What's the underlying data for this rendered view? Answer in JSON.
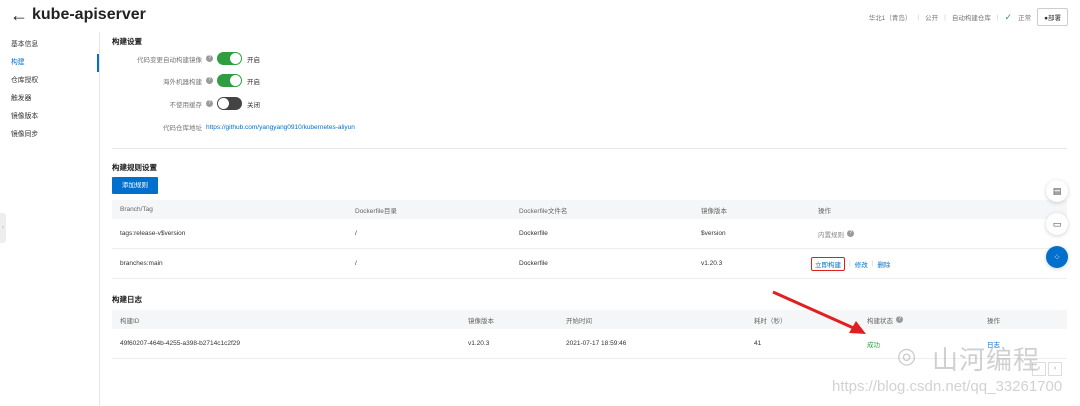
{
  "header": {
    "back_glyph": "←",
    "title": "kube-apiserver",
    "region": "华北1（青岛）",
    "visibility": "公开",
    "auto_build": "自动构建仓库",
    "status": "正常",
    "deploy_label": "●部署"
  },
  "sidebar": {
    "items": [
      {
        "label": "基本信息"
      },
      {
        "label": "构建"
      },
      {
        "label": "仓库授权"
      },
      {
        "label": "触发器"
      },
      {
        "label": "镜像版本"
      },
      {
        "label": "镜像同步"
      }
    ],
    "active_index": 1
  },
  "build_settings": {
    "title": "构建设置",
    "rows": [
      {
        "label": "代码变更自动构建镜像",
        "state": "开启"
      },
      {
        "label": "海外机器构建",
        "state": "开启"
      },
      {
        "label": "不使用缓存",
        "state": "关闭"
      }
    ],
    "repo_label": "代码仓库地址",
    "repo_url": "https://github.com/yangyang0910/kubernetes-aliyun"
  },
  "build_rules": {
    "title": "构建规则设置",
    "add_label": "添加规则",
    "columns": [
      "Branch/Tag",
      "Dockerfile目录",
      "Dockerfile文件名",
      "镜像版本",
      "操作"
    ],
    "rows": [
      {
        "branch": "tags:release-v$version",
        "dir": "/",
        "file": "Dockerfile",
        "version": "$version",
        "op_builtin": "内置规则"
      },
      {
        "branch": "branches:main",
        "dir": "/",
        "file": "Dockerfile",
        "version": "v1.20.3",
        "op_build": "立即构建",
        "op_edit": "修改",
        "op_delete": "删除"
      }
    ]
  },
  "build_log": {
    "title": "构建日志",
    "columns": [
      "构建ID",
      "镜像版本",
      "开始时间",
      "耗时（秒）",
      "构建状态",
      "操作"
    ],
    "rows": [
      {
        "id": "49f60207-464b-4255-a398-b2714c1c2f29",
        "version": "v1.20.3",
        "start": "2021-07-17 18:59:46",
        "duration": "41",
        "status": "成功",
        "op": "日志"
      }
    ]
  },
  "watermark": {
    "brand": "山河编程",
    "url": "https://blog.csdn.net/qq_33261700"
  },
  "colors": {
    "accent": "#0070cc",
    "success": "#2e9e41",
    "highlight": "#e02020"
  }
}
